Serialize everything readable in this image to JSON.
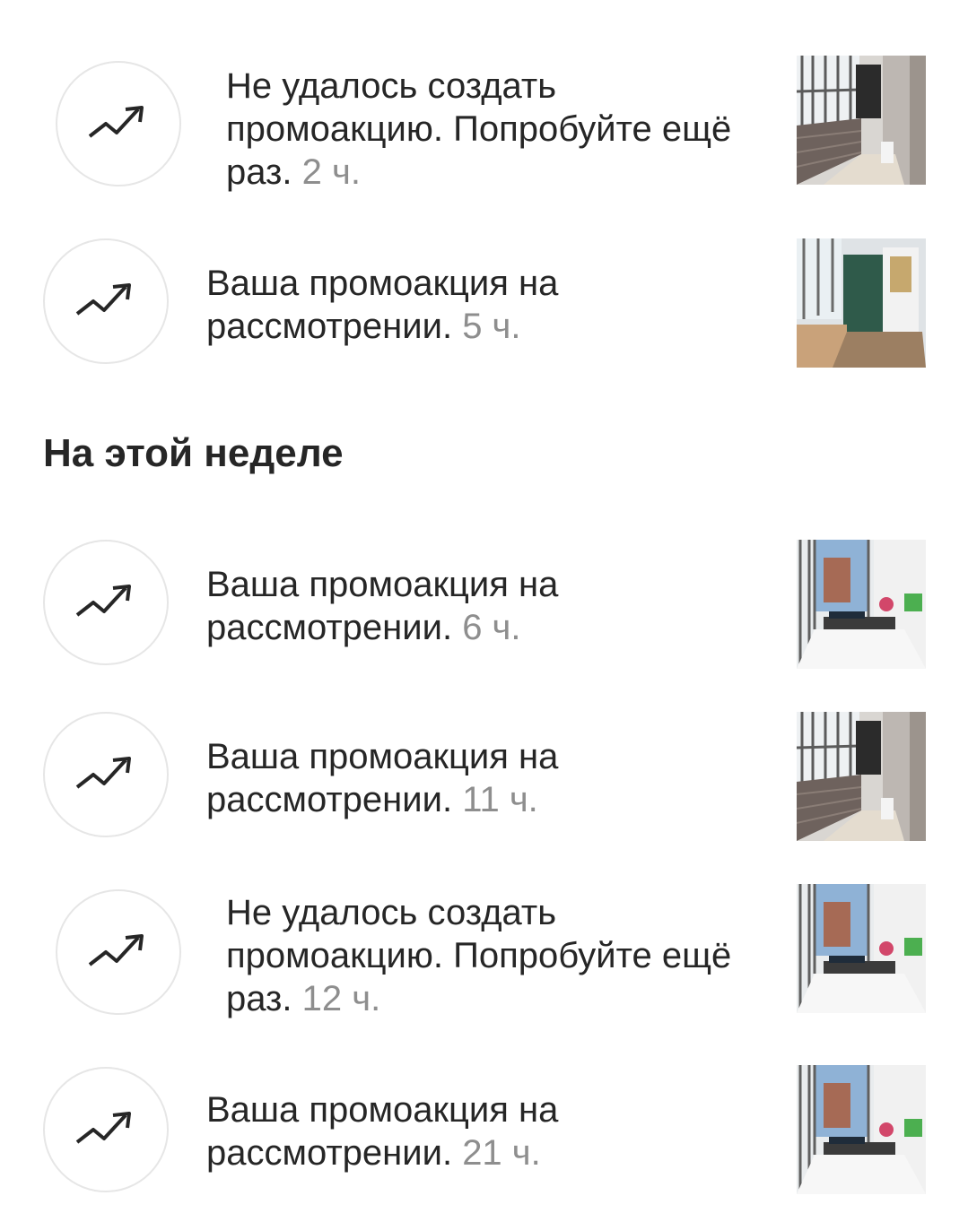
{
  "section_header": "На этой неделе",
  "notifications": [
    {
      "text": "Не удалось создать промоакцию. Попробуйте ещё раз.",
      "time": "2 ч.",
      "thumb": "balcony-brick",
      "icon": "trending-up-icon"
    },
    {
      "text": "Ваша промоакция на рассмотрении.",
      "time": "5 ч.",
      "thumb": "balcony-green-door",
      "icon": "trending-up-icon"
    },
    {
      "text": "Ваша промоакция на рассмотрении.",
      "time": "6 ч.",
      "thumb": "balcony-white-flowers",
      "icon": "trending-up-icon"
    },
    {
      "text": "Ваша промоакция на рассмотрении.",
      "time": "11 ч.",
      "thumb": "balcony-brick",
      "icon": "trending-up-icon"
    },
    {
      "text": "Не удалось создать промоакцию. Попробуйте ещё раз.",
      "time": "12 ч.",
      "thumb": "balcony-white-flowers",
      "icon": "trending-up-icon"
    },
    {
      "text": "Ваша промоакция на рассмотрении.",
      "time": "21 ч.",
      "thumb": "balcony-white-flowers",
      "icon": "trending-up-icon"
    }
  ],
  "colors": {
    "text": "#262626",
    "muted": "#8e8e8e",
    "border": "#e6e6e6"
  }
}
